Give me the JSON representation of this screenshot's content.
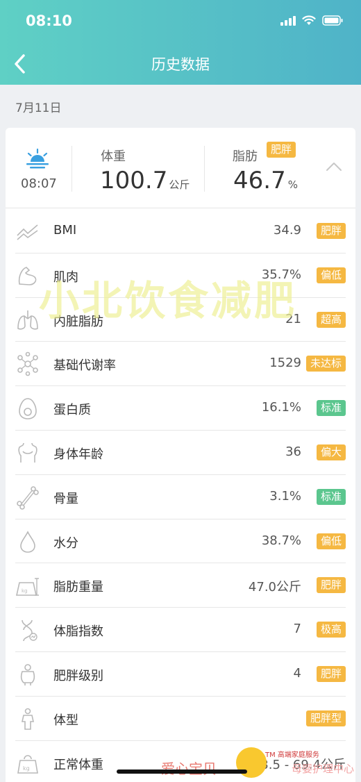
{
  "status_bar": {
    "time": "08:10"
  },
  "nav": {
    "title": "历史数据"
  },
  "date": "7月11日",
  "summary": {
    "time": "08:07",
    "weight_label": "体重",
    "weight_value": "100.7",
    "weight_unit": "公斤",
    "fat_label": "脂肪",
    "fat_badge": "肥胖",
    "fat_value": "46.7",
    "fat_unit": "%"
  },
  "metrics": [
    {
      "icon": "trend-icon",
      "label": "BMI",
      "value": "34.9",
      "badge": "肥胖",
      "badge_color": "#f5b842"
    },
    {
      "icon": "muscle-icon",
      "label": "肌肉",
      "value": "35.7%",
      "badge": "偏低",
      "badge_color": "#f5b842"
    },
    {
      "icon": "lungs-icon",
      "label": "内脏脂肪",
      "value": "21",
      "badge": "超高",
      "badge_color": "#f5b842"
    },
    {
      "icon": "molecule-icon",
      "label": "基础代谢率",
      "value": "1529",
      "badge": "未达标",
      "badge_color": "#f5b842"
    },
    {
      "icon": "egg-icon",
      "label": "蛋白质",
      "value": "16.1%",
      "badge": "标准",
      "badge_color": "#5bc68e"
    },
    {
      "icon": "body-icon",
      "label": "身体年龄",
      "value": "36",
      "badge": "偏大",
      "badge_color": "#f5b842"
    },
    {
      "icon": "bone-icon",
      "label": "骨量",
      "value": "3.1%",
      "badge": "标准",
      "badge_color": "#5bc68e"
    },
    {
      "icon": "water-drop-icon",
      "label": "水分",
      "value": "38.7%",
      "badge": "偏低",
      "badge_color": "#f5b842"
    },
    {
      "icon": "scale-weight-icon",
      "label": "脂肪重量",
      "value": "47.0公斤",
      "badge": "肥胖",
      "badge_color": "#f5b842"
    },
    {
      "icon": "dna-icon",
      "label": "体脂指数",
      "value": "7",
      "badge": "极高",
      "badge_color": "#f5b842"
    },
    {
      "icon": "person-level-icon",
      "label": "肥胖级别",
      "value": "4",
      "badge": "肥胖",
      "badge_color": "#f5b842"
    },
    {
      "icon": "person-icon",
      "label": "体型",
      "value": "",
      "badge": "肥胖型",
      "badge_color": "#f5b842"
    },
    {
      "icon": "kg-weight-icon",
      "label": "正常体重",
      "value": "53.5 - 69.4公斤",
      "badge": "",
      "badge_color": "#f5b842"
    }
  ],
  "watermarks": {
    "main": "小北饮食减肥",
    "brand": "爱心宝贝",
    "tm": "TM 高端家庭服务",
    "center": "母婴护理中心"
  }
}
